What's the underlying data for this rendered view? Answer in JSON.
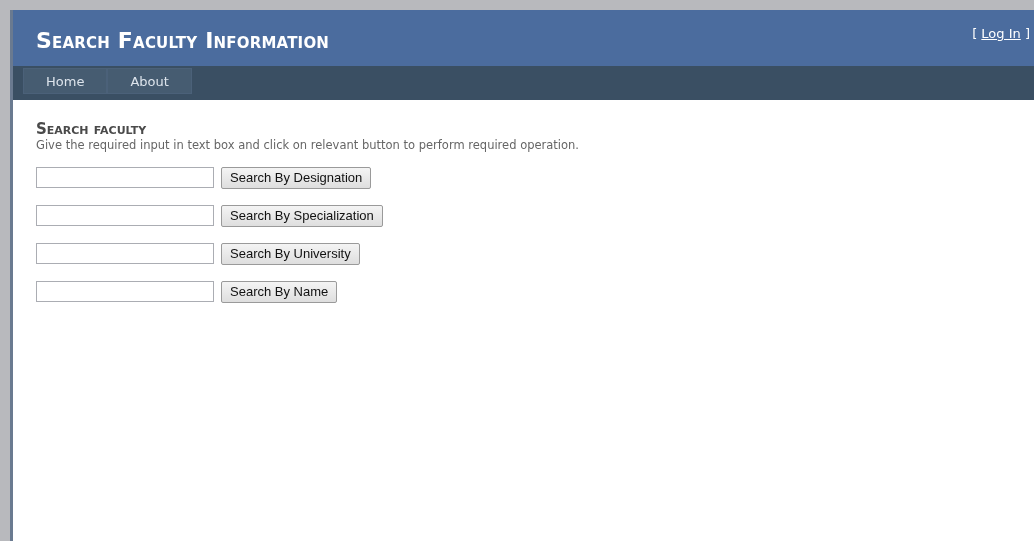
{
  "header": {
    "title": "Search Faculty Information",
    "login": {
      "open": "[",
      "link": "Log In",
      "close": "]"
    }
  },
  "nav": [
    {
      "label": "Home"
    },
    {
      "label": "About"
    }
  ],
  "main": {
    "heading": "Search faculty",
    "description": "Give the required input in text box and click on relevant button to perform required operation.",
    "searches": [
      {
        "button": "Search By Designation"
      },
      {
        "button": "Search By Specialization"
      },
      {
        "button": "Search By University"
      },
      {
        "button": "Search By Name"
      }
    ]
  }
}
